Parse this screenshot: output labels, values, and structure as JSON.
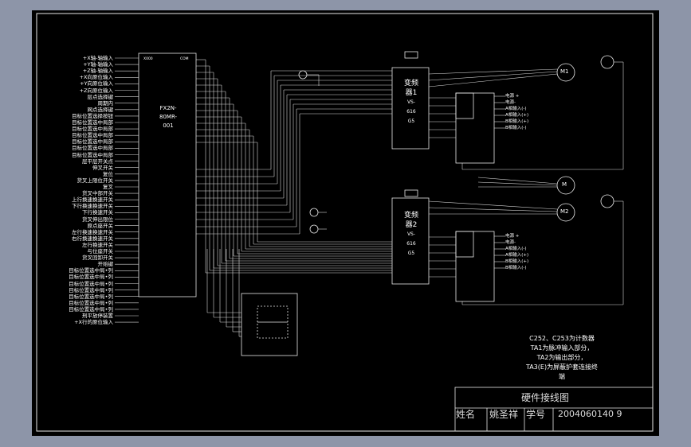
{
  "plc": {
    "model_lines": [
      "FX2N-",
      "80MR-",
      "001"
    ]
  },
  "left_inputs": [
    "+X轴-轴输入",
    "+Y轴-轴输入",
    "+Z轴-轴输入",
    "+X向原位输入",
    "+Y向原位输入",
    "+Z向原位输入",
    "层点选择键",
    "周期内",
    "网点选择键",
    "目标位置选择按钮",
    "目标位置选中局部",
    "目标位置选中局部",
    "目标位置选中局部",
    "目标位置选中局部",
    "目标位置选中局部",
    "目标位置选中局部",
    "层平层开关点",
    "伸叉开关",
    "复位",
    "货叉上限位开关",
    "复叉",
    "货叉中部开关",
    "上行换速换速开关",
    "下行换速换速开关",
    "下行换速开关",
    "货叉伸出限位",
    "原点座开关",
    "左行换速换速开关",
    "右行换速换速开关",
    "左行换速开关",
    "与位座开关",
    "货叉回卸开关",
    "开始键",
    "目标位置选中局•列",
    "目标位置选中局•列",
    "目标位置选中局•列",
    "目标位置选中局•列",
    "目标位置选中局•列",
    "目标位置选中局•列",
    "目标位置选中局•列",
    "刑平放停装置",
    "+X行的原位输入"
  ],
  "inverter1": {
    "lines": [
      "变频",
      "器1",
      "VS-",
      "616",
      "G5"
    ]
  },
  "inverter2": {
    "lines": [
      "变频",
      "器2",
      "VS-",
      "616",
      "G5"
    ]
  },
  "pg_labels": [
    "电源 +",
    "电源-",
    "A相输入(-)",
    "A相输入(+)",
    "B相输入(+)",
    "B相输入(-)"
  ],
  "motors": [
    "M1",
    "M",
    "M2"
  ],
  "notes": [
    "C252、C253为计数器",
    "TA1为脉冲输入部分，",
    "TA2为输出部分，",
    "TA3(E)为屏蔽护套连接终",
    "端"
  ],
  "title_block": {
    "title": "硬件接线图",
    "name_label": "姓名",
    "name": "姚圣祥",
    "id_label": "学号",
    "id": "2004060140 9"
  }
}
